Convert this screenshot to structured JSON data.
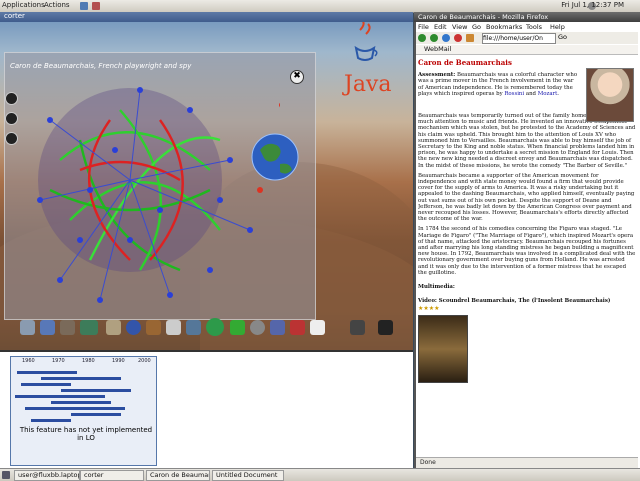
{
  "top_panel": {
    "menus": [
      "Applications",
      "Actions"
    ],
    "clock": "Fri Jul 1, 12:37 PM"
  },
  "left_window": {
    "title": "corter",
    "panel_title": "Caron de Beaumarchais, French playwright and spy",
    "close_glyph": "✖",
    "java_label": "Java"
  },
  "timeline": {
    "years": [
      "1960",
      "1970",
      "1980",
      "1990",
      "2000"
    ],
    "note": "This feature has not yet implemented in LO"
  },
  "taskbar": {
    "items": [
      "user@fluxbb.laptop:~",
      "corter",
      "Caron de Beaumarchais",
      "Untitled Document"
    ]
  },
  "browser": {
    "title": "Caron de Beaumarchais - Mozilla Firefox",
    "menus": [
      "File",
      "Edit",
      "View",
      "Go",
      "Bookmarks",
      "Tools",
      "Help"
    ],
    "url": "file:///home/user/On",
    "go_label": "Go",
    "bookmark": "WebMail",
    "status": "Done"
  },
  "article": {
    "heading": "Caron de Beaumarchais",
    "assessment_label": "Assessment:",
    "assessment": "Beaumarchais was a colorful character who was a prime mover in the French involvement in the war of American independence. He is remembered today the plays which inspired operas by",
    "assessment_links": [
      "Rossini",
      "Mozart"
    ],
    "p1": "Beaumarchais was temporarily turned out of the family home for paying too much attention to music and friends. He invented an innovative escapement mechanism which was stolen, but he protested to the Academy of Sciences and his claim was upheld. This brought him to the attention of Louis XV who summoned him to Versailles. Beaumarchais was able to buy himself the job of Secretary to the King and noble status. When financial problems landed him in prison, he was happy to undertake a secret mission to England for Louis. Then the new new king needed a discreet envoy and Beaumarchais was dispatched. In the midst of these missions, he wrote the comedy \"The Barber of Seville.\"",
    "p2": "Beaumarchais became a supporter of the American movement for independence and with state money would found a firm that would provide cover for the supply of arms to America. It was a risky undertaking but it appealed to the dashing Beaumarchais, who applied himself, eventually paying out vast sums out of his own pocket. Despite the support of Deane and Jefferson, he was badly let down by the American Congress over payment and never recouped his losses. However, Beaumarchais's efforts directly affected the outcome of the war.",
    "p3": "In 1784 the second of his comedies concerning the Figaro was staged. \"Le Mariage de Figaro\" (\"The Marriage of Figaro\"), which inspired Mozart's opera of that name, attacked the aristocracy. Beaumarchais recouped his fortunes and after marrying his long standing mistress he began building a magnificent new house. In 1792, Beaumarchais was involved in a complicated deal with the revolutionary government over buying guns from Holland. He was arrested and it was only due to the intervention of a former mistress that he escaped the guillotine.",
    "multimedia_label": "Multimedia:",
    "video_label": "Video: Scoundrel Beaumarchais, The (l'Insolent Beaumarchais)",
    "stars": "★★★★"
  }
}
